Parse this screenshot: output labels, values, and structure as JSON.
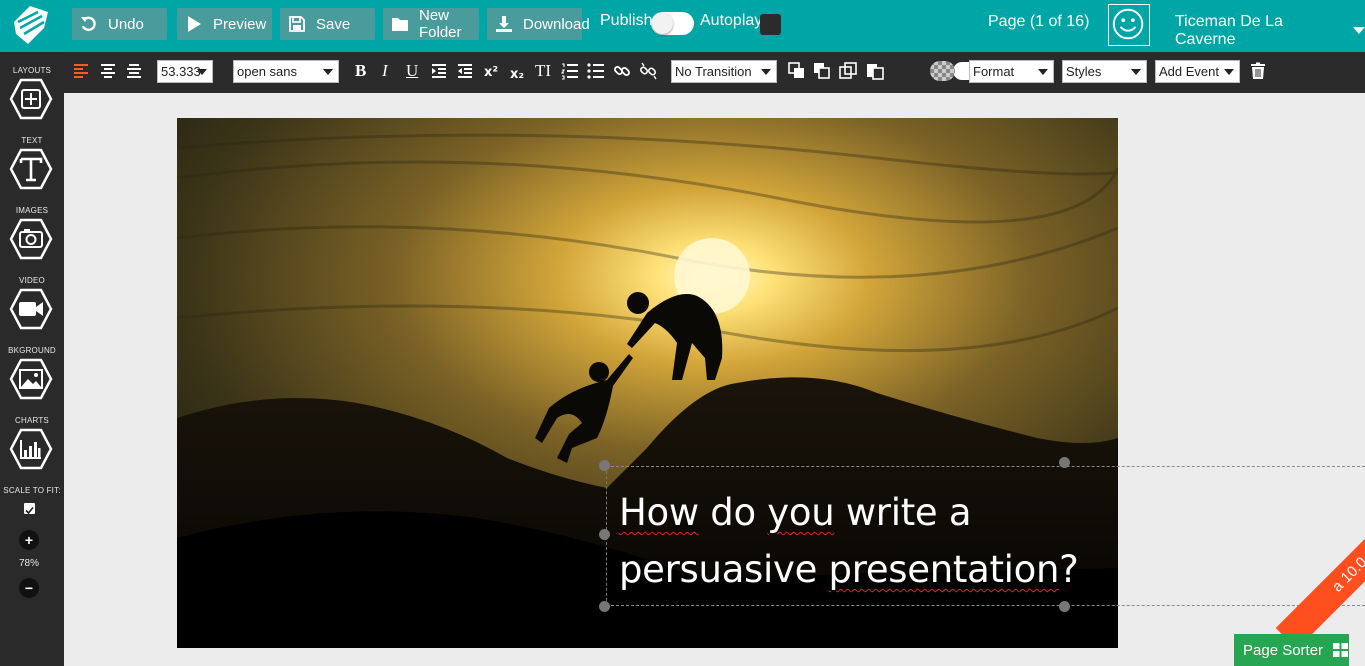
{
  "app": {
    "accent_color": "#00a6a6",
    "sidebar_color": "#2a2a2a"
  },
  "topbar": {
    "undo": "Undo",
    "preview": "Preview",
    "save": "Save",
    "new_folder": "New Folder",
    "download": "Download",
    "publish_label": "Publish:",
    "publish_on": false,
    "autoplay_label": "Autoplay:",
    "page_info": "Page (1 of 16)",
    "username": "Ticeman De La Caverne"
  },
  "sidebar": {
    "layouts": "LAYOUTS",
    "text": "TEXT",
    "images": "IMAGES",
    "video": "VIDEO",
    "background": "BKGROUND",
    "charts": "CHARTS",
    "scale_to_fit": "SCALE TO FIT:",
    "scale_to_fit_checked": true,
    "zoom_in": "+",
    "zoom_level": "78%",
    "zoom_out": "−"
  },
  "format_toolbar": {
    "font_size": "53.333",
    "font_family": "open sans",
    "bold": "B",
    "italic": "I",
    "underline": "U",
    "superscript": "x²",
    "subscript": "x₂",
    "text_height": "TI",
    "transition": "No Transition",
    "format": "Format",
    "styles": "Styles",
    "add_event": "Add Event"
  },
  "slide": {
    "headline_line1": [
      {
        "text": "How",
        "sq": true
      },
      {
        "text": " do ",
        "sq": false
      },
      {
        "text": "you",
        "sq": true
      },
      {
        "text": " write a",
        "sq": false
      }
    ],
    "headline_line2": [
      {
        "text": "persuasive ",
        "sq": false
      },
      {
        "text": "presentation",
        "sq": true
      },
      {
        "text": "?",
        "sq": false
      }
    ]
  },
  "ribbon": "a 10.0",
  "page_sorter": "Page Sorter"
}
